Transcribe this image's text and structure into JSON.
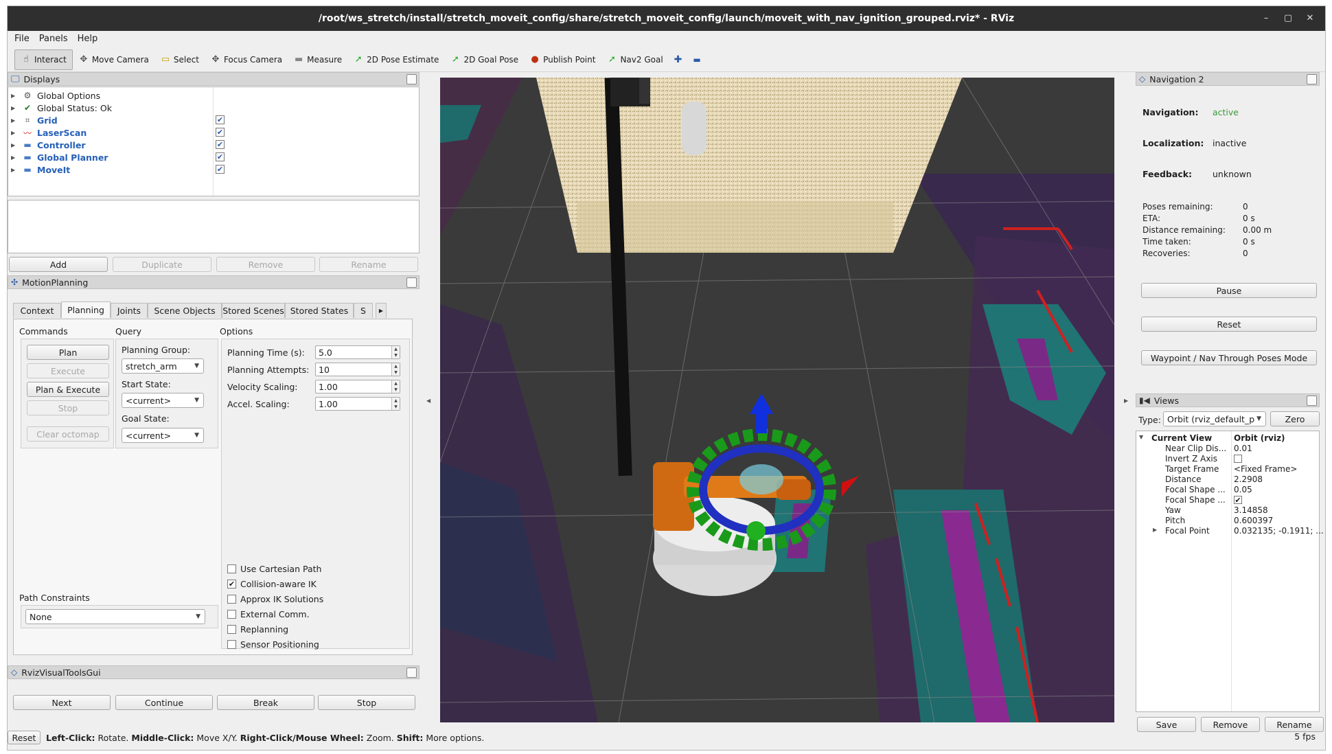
{
  "window": {
    "title": "/root/ws_stretch/install/stretch_moveit_config/share/stretch_moveit_config/launch/moveit_with_nav_ignition_grouped.rviz* - RViz",
    "minimize_glyph": "–",
    "maximize_glyph": "▢",
    "close_glyph": "✕"
  },
  "menu": [
    "File",
    "Panels",
    "Help"
  ],
  "toolbar": [
    {
      "label": "Interact",
      "icon": "hand-icon",
      "glyph": "☝",
      "color": "#333333"
    },
    {
      "label": "Move Camera",
      "icon": "move-camera-icon",
      "glyph": "✥",
      "color": "#555555"
    },
    {
      "label": "Select",
      "icon": "select-icon",
      "glyph": "▭",
      "color": "#c8a000"
    },
    {
      "label": "Focus Camera",
      "icon": "focus-camera-icon",
      "glyph": "✥",
      "color": "#555555"
    },
    {
      "label": "Measure",
      "icon": "measure-icon",
      "glyph": "▬",
      "color": "#888888"
    },
    {
      "label": "2D Pose Estimate",
      "icon": "pose-estimate-icon",
      "glyph": "➚",
      "color": "#22aa22"
    },
    {
      "label": "2D Goal Pose",
      "icon": "goal-pose-icon",
      "glyph": "➚",
      "color": "#22aa22"
    },
    {
      "label": "Publish Point",
      "icon": "publish-point-icon",
      "glyph": "●",
      "color": "#c03010"
    },
    {
      "label": "Nav2 Goal",
      "icon": "nav2-goal-icon",
      "glyph": "➚",
      "color": "#22aa22"
    }
  ],
  "toolbar_extra": {
    "add_tool_glyph": "✚",
    "remove_tool_glyph": "▬"
  },
  "displays": {
    "title": "Displays",
    "items": [
      {
        "label": "Global Options",
        "icon": "gear-icon",
        "glyph": "⚙",
        "checked": null,
        "blue": false
      },
      {
        "label": "Global Status: Ok",
        "icon": "check-icon",
        "glyph": "✔",
        "checked": null,
        "blue": false
      },
      {
        "label": "Grid",
        "icon": "grid-icon",
        "glyph": "⌗",
        "checked": true,
        "blue": true
      },
      {
        "label": "LaserScan",
        "icon": "laserscan-icon",
        "glyph": "〰",
        "checked": true,
        "blue": true
      },
      {
        "label": "Controller",
        "icon": "folder-icon",
        "glyph": "▬",
        "checked": true,
        "blue": true
      },
      {
        "label": "Global Planner",
        "icon": "folder-icon",
        "glyph": "▬",
        "checked": true,
        "blue": true
      },
      {
        "label": "MoveIt",
        "icon": "folder-icon",
        "glyph": "▬",
        "checked": true,
        "blue": true
      }
    ],
    "buttons": {
      "add": "Add",
      "duplicate": "Duplicate",
      "remove": "Remove",
      "rename": "Rename"
    }
  },
  "motion_planning": {
    "title": "MotionPlanning",
    "tabs": [
      "Context",
      "Planning",
      "Joints",
      "Scene Objects",
      "Stored Scenes",
      "Stored States",
      "S"
    ],
    "commands": {
      "title": "Commands",
      "plan": "Plan",
      "execute": "Execute",
      "plan_execute": "Plan & Execute",
      "stop": "Stop",
      "clear_octomap": "Clear octomap"
    },
    "query": {
      "title": "Query",
      "planning_group_label": "Planning Group:",
      "planning_group": "stretch_arm",
      "start_state_label": "Start State:",
      "start_state": "<current>",
      "goal_state_label": "Goal State:",
      "goal_state": "<current>"
    },
    "options": {
      "title": "Options",
      "fields": [
        {
          "label": "Planning Time (s):",
          "value": "5.0"
        },
        {
          "label": "Planning Attempts:",
          "value": "10"
        },
        {
          "label": "Velocity Scaling:",
          "value": "1.00"
        },
        {
          "label": "Accel. Scaling:",
          "value": "1.00"
        }
      ],
      "checks": [
        {
          "label": "Use Cartesian Path",
          "checked": false
        },
        {
          "label": "Collision-aware IK",
          "checked": true
        },
        {
          "label": "Approx IK Solutions",
          "checked": false
        },
        {
          "label": "External Comm.",
          "checked": false
        },
        {
          "label": "Replanning",
          "checked": false
        },
        {
          "label": "Sensor Positioning",
          "checked": false
        }
      ]
    },
    "path_constraints": {
      "label": "Path Constraints",
      "value": "None"
    }
  },
  "rviz_visual_tools": {
    "title": "RvizVisualToolsGui",
    "buttons": [
      "Next",
      "Continue",
      "Break",
      "Stop"
    ]
  },
  "navigation2": {
    "title": "Navigation 2",
    "navigation_label": "Navigation:",
    "navigation": "active",
    "localization_label": "Localization:",
    "localization": "inactive",
    "feedback_label": "Feedback:",
    "feedback": "unknown",
    "stats": [
      {
        "label": "Poses remaining:",
        "value": "0"
      },
      {
        "label": "ETA:",
        "value": "0 s"
      },
      {
        "label": "Distance remaining:",
        "value": "0.00 m"
      },
      {
        "label": "Time taken:",
        "value": "0 s"
      },
      {
        "label": "Recoveries:",
        "value": "0"
      }
    ],
    "buttons": {
      "pause": "Pause",
      "reset": "Reset",
      "waypoint": "Waypoint / Nav Through Poses Mode"
    }
  },
  "views": {
    "title": "Views",
    "type_label": "Type:",
    "type_value": "Orbit (rviz_default_p",
    "zero": "Zero",
    "current_view": "Current View",
    "current_view_type": "Orbit (rviz)",
    "props": [
      {
        "name": "Near Clip Dis...",
        "value": "0.01"
      },
      {
        "name": "Invert Z Axis",
        "value": "",
        "checkbox": false
      },
      {
        "name": "Target Frame",
        "value": "<Fixed Frame>"
      },
      {
        "name": "Distance",
        "value": "2.2908"
      },
      {
        "name": "Focal Shape ...",
        "value": "0.05"
      },
      {
        "name": "Focal Shape ...",
        "value": "",
        "checkbox": true
      },
      {
        "name": "Yaw",
        "value": "3.14858"
      },
      {
        "name": "Pitch",
        "value": "0.600397"
      },
      {
        "name": "Focal Point",
        "value": "0.032135; -0.1911; ..."
      }
    ],
    "buttons": {
      "save": "Save",
      "remove": "Remove",
      "rename": "Rename"
    }
  },
  "status": {
    "reset": "Reset",
    "hint_b1": "Left-Click:",
    "hint_t1": " Rotate. ",
    "hint_b2": "Middle-Click:",
    "hint_t2": " Move X/Y. ",
    "hint_b3": "Right-Click/Mouse Wheel:",
    "hint_t3": " Zoom. ",
    "hint_b4": "Shift:",
    "hint_t4": " More options.",
    "fps": "5 fps"
  },
  "colors": {
    "accent_blue": "#2560b8",
    "active_green": "#3a9a3a",
    "titlebar": "#2f2f2f"
  }
}
